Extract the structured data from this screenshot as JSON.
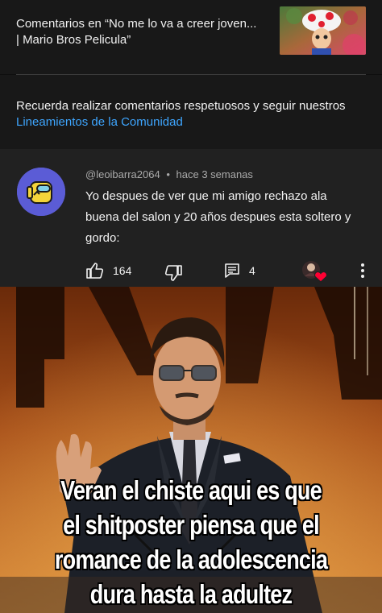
{
  "header": {
    "video_title": "Comentarios en “No me lo va a creer joven... | Mario Bros Pelicula”"
  },
  "guidelines": {
    "text": "Recuerda realizar comentarios respetuosos y seguir nuestros ",
    "link": "Lineamientos de la Comunidad"
  },
  "comment": {
    "author": "@leoibarra2064",
    "separator": "•",
    "time": "hace 3 semanas",
    "text": "Yo despues de ver que mi amigo rechazo ala buena del salon y 20 años despues esta soltero y gordo:",
    "likes": "164",
    "replies": "4",
    "icons": [
      "thumb-up-icon",
      "thumb-down-icon",
      "reply-icon",
      "creator-heart-icon",
      "more-icon"
    ]
  },
  "meme": {
    "caption_lines": [
      "Veran el chiste aqui es que",
      "el shitposter piensa que el",
      "romance de la adolescencia",
      "dura hasta la adultez"
    ]
  },
  "colors": {
    "link": "#3ea6ff",
    "background": "#0f0f0f",
    "comment_bg": "#212121",
    "heart": "#ff0033"
  }
}
